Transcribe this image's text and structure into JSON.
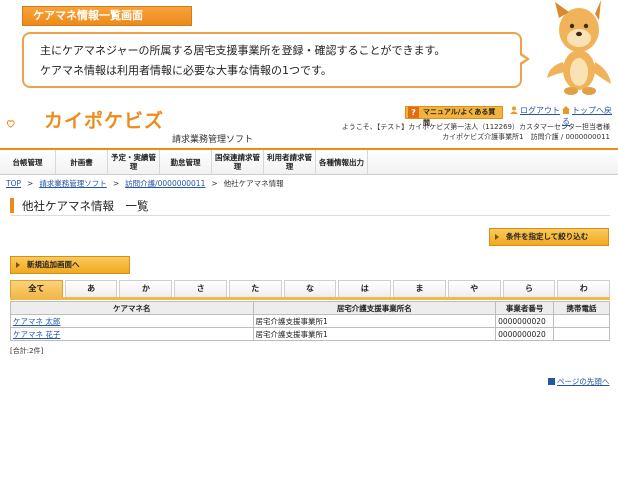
{
  "explanation": {
    "tag": "ケアマネ情報一覧画面",
    "line1": "主にケアマネジャーの所属する居宅支援事業所を登録・確認することができます。",
    "line2": "ケアマネ情報は利用者情報に必要な大事な情報の1つです。"
  },
  "header": {
    "logo_text": "カイポケビズ",
    "logo_subtitle": "請求業務管理ソフト",
    "manual_label": "マニュアル/よくある質問",
    "manual_icon": "?",
    "logout_label": "ログアウト",
    "top_label": "トップへ戻る",
    "welcome_line1": "ようこそ、【テスト】カイポケビズ第一法人（112269）カスタマーセンター担当者様",
    "welcome_line2": "カイポケビズ介護事業所1　訪問介護 / 0000000011"
  },
  "nav": [
    {
      "label": "台帳管理"
    },
    {
      "label": "計画書"
    },
    {
      "label": "予定・実績管理"
    },
    {
      "label": "勤怠管理"
    },
    {
      "label": "国保連請求管理"
    },
    {
      "label": "利用者請求管理"
    },
    {
      "label": "各種情報出力"
    }
  ],
  "breadcrumb": {
    "items": [
      "TOP",
      "請求業務管理ソフト",
      "訪問介護/0000000011"
    ],
    "current": "他社ケアマネ情報",
    "separator": ">"
  },
  "page": {
    "title": "他社ケアマネ情報　一覧",
    "filter_button": "条件を指定して絞り込む",
    "new_button": "新規追加画面へ"
  },
  "tabs": [
    {
      "label": "全て",
      "active": true
    },
    {
      "label": "あ"
    },
    {
      "label": "か"
    },
    {
      "label": "さ"
    },
    {
      "label": "た"
    },
    {
      "label": "な"
    },
    {
      "label": "は"
    },
    {
      "label": "ま"
    },
    {
      "label": "や"
    },
    {
      "label": "ら"
    },
    {
      "label": "わ"
    }
  ],
  "table": {
    "headers": [
      "ケアマネ名",
      "居宅介護支援事業所名",
      "事業者番号",
      "携帯電話"
    ],
    "rows": [
      [
        "ケアマネ 太郎",
        "居宅介護支援事業所1",
        "0000000020",
        ""
      ],
      [
        "ケアマネ 花子",
        "居宅介護支援事業所1",
        "0000000020",
        ""
      ]
    ],
    "total": "[合計:2件]"
  },
  "footer": {
    "page_top": "ページの先頭へ"
  },
  "colors": {
    "accent": "#ee8a1a",
    "link": "#2456a6",
    "button": "#f2a91f"
  }
}
